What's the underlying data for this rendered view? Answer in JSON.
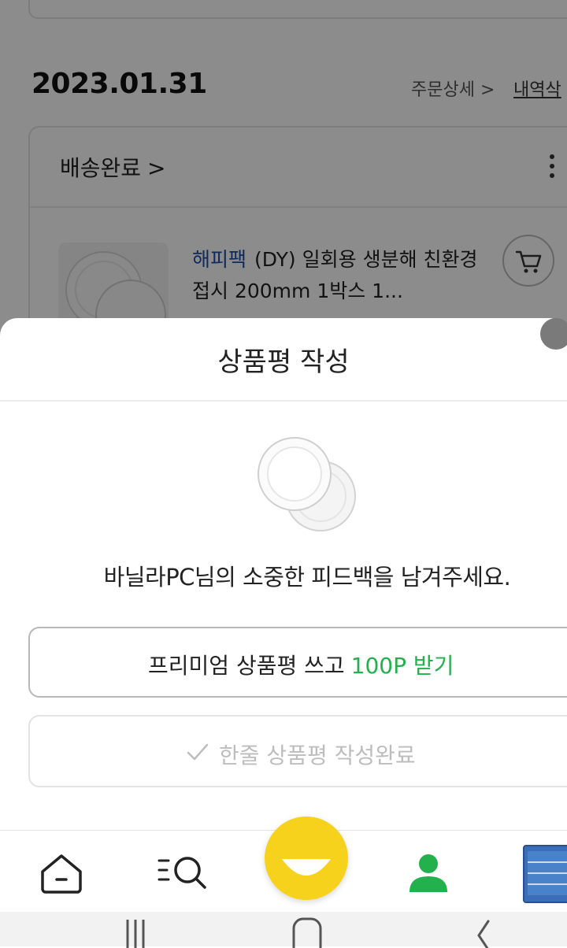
{
  "background_page": {
    "order_date": "2023.01.31",
    "order_detail_link": "주문상세 >",
    "delete_link": "내역삭",
    "delivery_status": "배송완료",
    "delivery_chevron": ">",
    "product_brand": "해피팩",
    "product_title": "(DY) 일회용 생분해 친환경 접시 200mm 1박스 1...",
    "cart_icon": "cart-icon",
    "more_icon": "kebab-menu-icon"
  },
  "review_sheet": {
    "title": "상품평 작성",
    "feedback_message": "바닐라PC님의 소중한 피드백을 남겨주세요.",
    "premium_button": {
      "label": "프리미엄 상품평 쓰고",
      "reward": "100P 받기",
      "reward_color": "#22b14c"
    },
    "oneline_button": {
      "label": "한줄 상품평 작성완료",
      "icon": "check-icon",
      "state": "disabled"
    }
  },
  "bottom_nav": {
    "items": [
      {
        "name": "home",
        "icon": "home-icon"
      },
      {
        "name": "category-search",
        "icon": "menu-search-icon"
      },
      {
        "name": "center",
        "icon": "smile-face-icon",
        "color": "#f7d21c"
      },
      {
        "name": "my",
        "icon": "person-icon",
        "color": "#22b14c"
      },
      {
        "name": "recent",
        "icon": "recent-product-thumb"
      }
    ]
  },
  "system_nav": {
    "icons": [
      "recents-icon",
      "home-circle-icon",
      "back-icon"
    ]
  }
}
